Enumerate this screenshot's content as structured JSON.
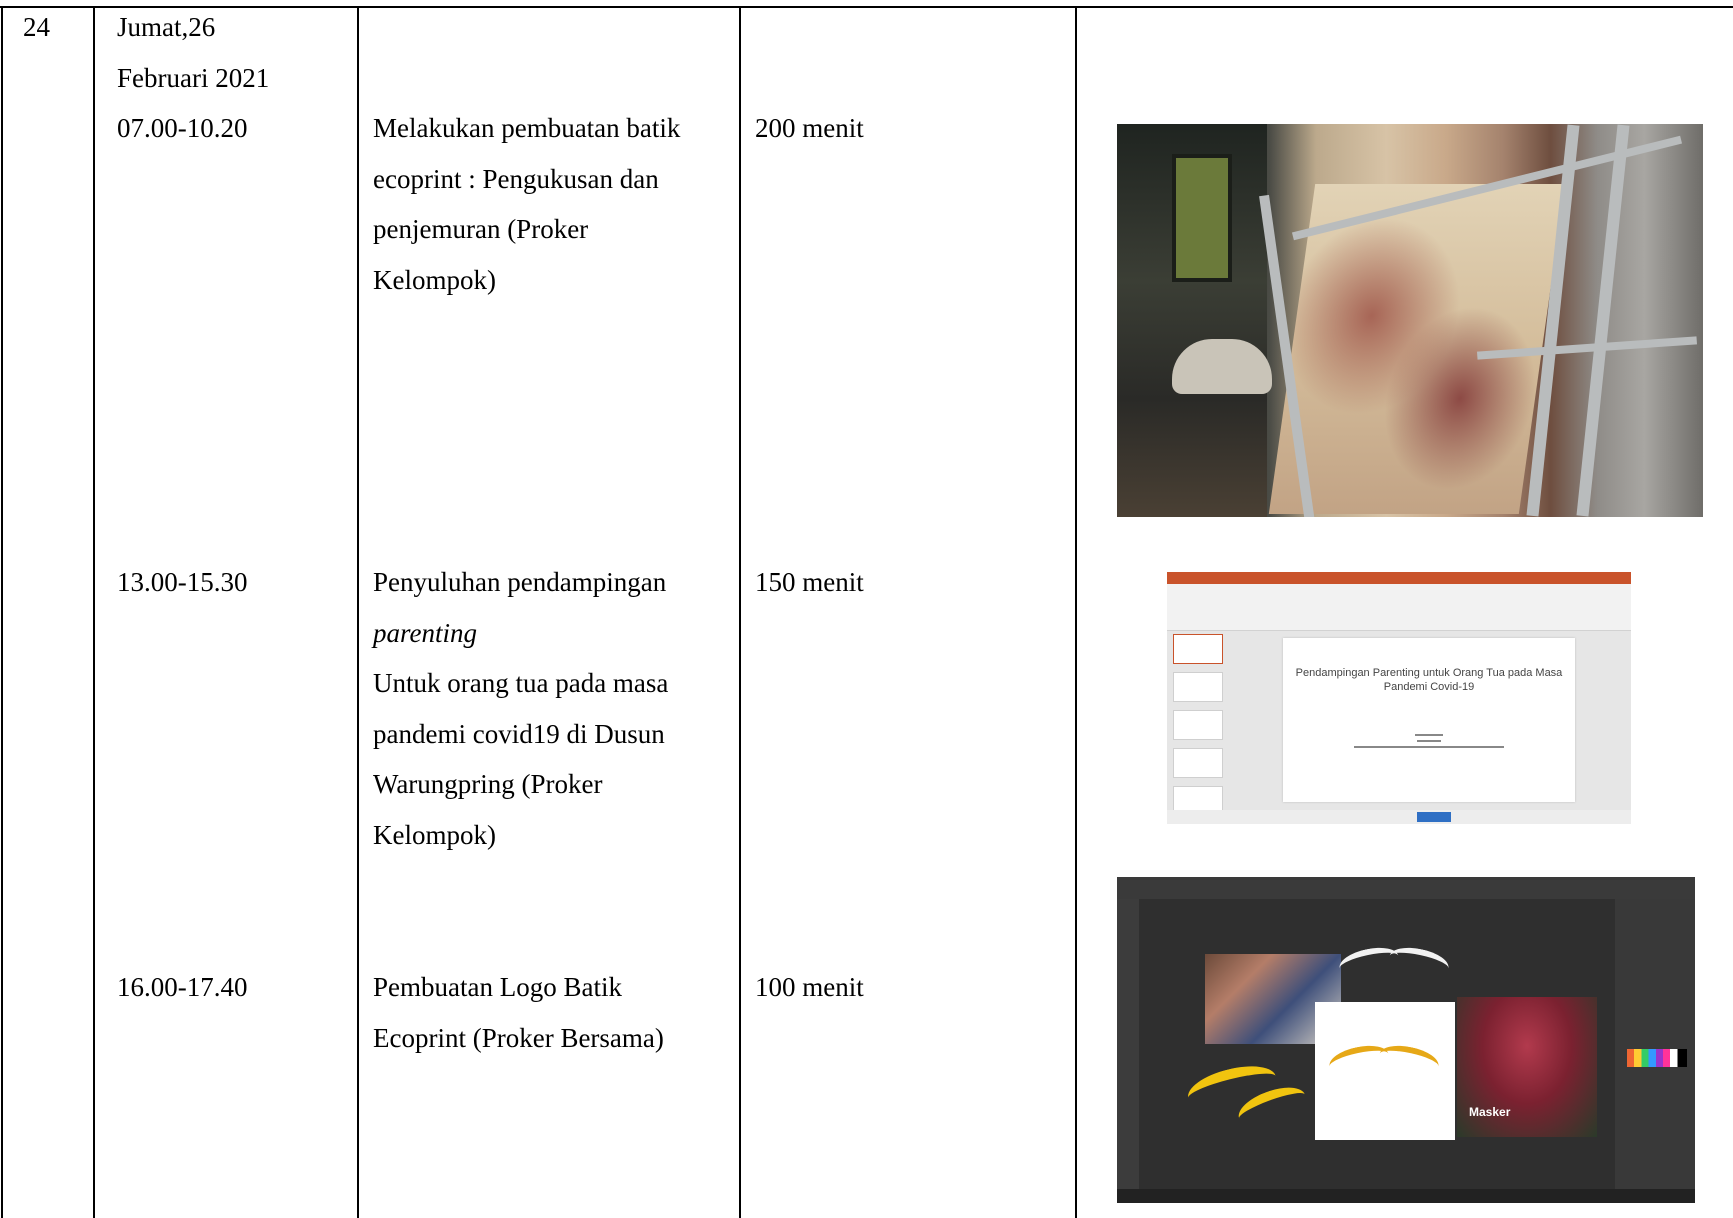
{
  "row": {
    "number": "24",
    "date_line1": "Jumat,26",
    "date_line2": "Februari 2021",
    "activities": [
      {
        "time": "07.00-10.20",
        "description_lines": [
          "Melakukan pembuatan batik",
          "ecoprint : Pengukusan dan",
          "penjemuran (Proker",
          "Kelompok)"
        ],
        "duration": "200 menit"
      },
      {
        "time": "13.00-15.30",
        "description_lines": [
          "Penyuluhan pendampingan",
          "parenting",
          "Untuk orang tua pada masa",
          "pandemi covid19 di Dusun",
          "Warungpring (Proker",
          "Kelompok)"
        ],
        "duration": "150 menit"
      },
      {
        "time": "16.00-17.40",
        "description_lines": [
          "Pembuatan Logo Batik",
          "Ecoprint (Proker Bersama)"
        ],
        "duration": "100 menit"
      }
    ]
  },
  "images": {
    "ppt_slide_title": "Pendampingan Parenting untuk Orang Tua pada Masa Pandemi Covid-19",
    "logo_masker_label": "Masker"
  },
  "colors": {
    "border": "#000000",
    "ppt_accent": "#c9532b",
    "logo_gold": "#e6a817"
  }
}
